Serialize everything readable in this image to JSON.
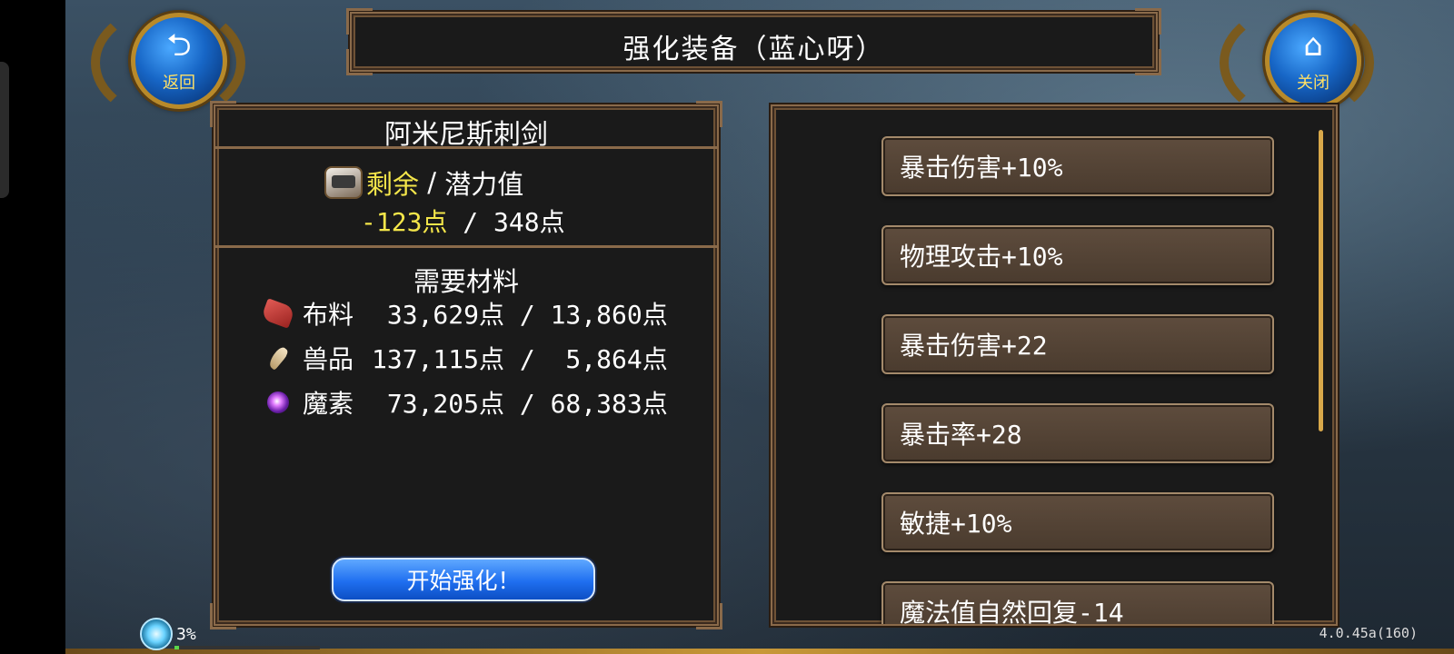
{
  "header": {
    "title": "强化装备（蓝心呀）",
    "back_label": "返回",
    "close_label": "关闭"
  },
  "equipment": {
    "name": "阿米尼斯刺剑",
    "potential_label_left": "剩余",
    "potential_sep": " / ",
    "potential_label_right": "潜力值",
    "remaining": "-123点",
    "values_sep": " / ",
    "total": "348点"
  },
  "materials": {
    "title": "需要材料",
    "items": [
      {
        "name": "布料",
        "values": " 33,629点 / 13,860点",
        "icon": "cloth-icon"
      },
      {
        "name": "兽品",
        "values": "137,115点 /  5,864点",
        "icon": "fang-icon"
      },
      {
        "name": "魔素",
        "values": " 73,205点 / 68,383点",
        "icon": "mana-orb-icon"
      }
    ]
  },
  "actions": {
    "start_label": "开始强化！"
  },
  "stats": [
    "暴击伤害+10%",
    "物理攻击+10%",
    "暴击伤害+22",
    "暴击率+28",
    "敏捷+10%",
    "魔法值自然回复-14"
  ],
  "status": {
    "progress_text": "3%",
    "progress_fraction": 0.03,
    "version": "4.0.45a(160)"
  },
  "colors": {
    "panel_border": "#8a6a4a",
    "highlight_yellow": "#f4e64a",
    "button_blue": "#1f6ff0",
    "stat_button": "#4a3b2e"
  }
}
